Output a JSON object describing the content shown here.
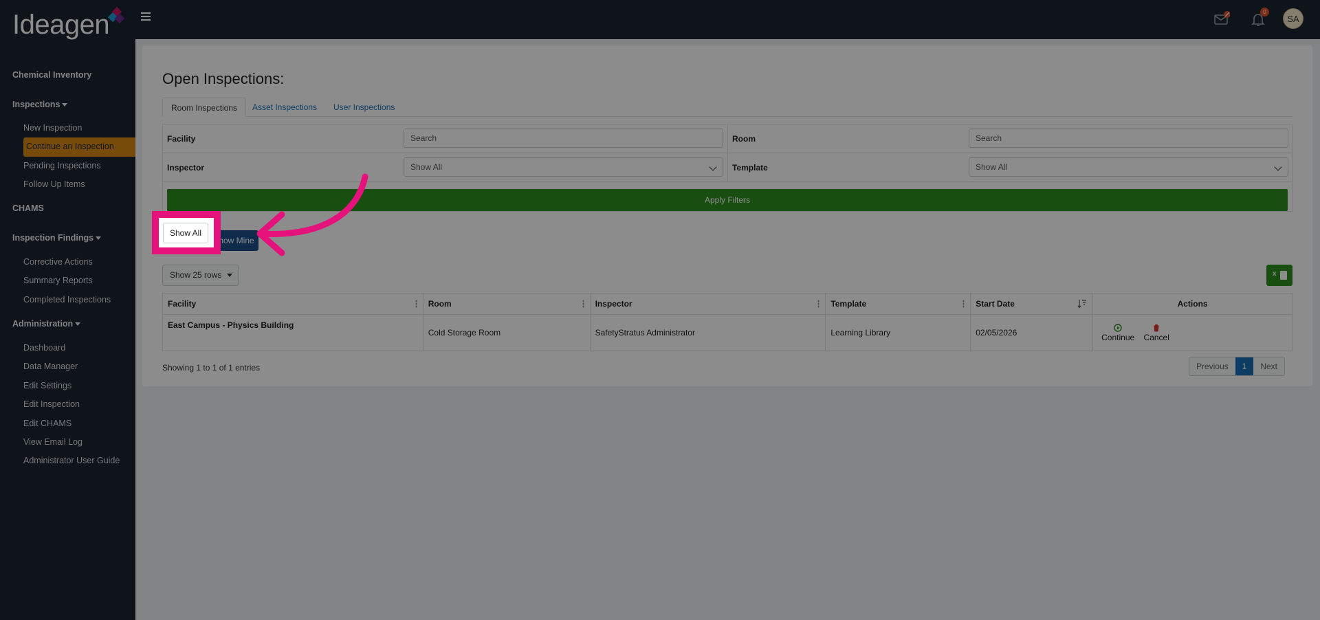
{
  "brand": {
    "logo_text": "Ideagen"
  },
  "sidebar": {
    "sections": [
      {
        "label": "Chemical Inventory"
      },
      {
        "label": "Inspections"
      },
      {
        "label": "CHAMS"
      },
      {
        "label": "Inspection Findings"
      },
      {
        "label": "Administration"
      }
    ],
    "items": [
      {
        "label": "New Inspection"
      },
      {
        "label": "Continue an Inspection"
      },
      {
        "label": "Pending Inspections"
      },
      {
        "label": "Follow Up Items"
      },
      {
        "label": "Corrective Actions"
      },
      {
        "label": "Summary Reports"
      },
      {
        "label": "Completed Inspections"
      },
      {
        "label": "Dashboard"
      },
      {
        "label": "Data Manager"
      },
      {
        "label": "Edit Settings"
      },
      {
        "label": "Edit Inspection"
      },
      {
        "label": "Edit CHAMS"
      },
      {
        "label": "View Email Log"
      },
      {
        "label": "Administrator User Guide"
      }
    ]
  },
  "topbar": {
    "notification_count": "0",
    "avatar_initials": "SA"
  },
  "page": {
    "title": "Open Inspections:"
  },
  "tabs": [
    {
      "label": "Room Inspections"
    },
    {
      "label": "Asset Inspections"
    },
    {
      "label": "User Inspections"
    }
  ],
  "filters": {
    "facility_label": "Facility",
    "facility_placeholder": "Search",
    "room_label": "Room",
    "room_placeholder": "Search",
    "inspector_label": "Inspector",
    "inspector_value": "Show All",
    "template_label": "Template",
    "template_value": "Show All",
    "apply_label": "Apply Filters"
  },
  "toggle": {
    "show_all": "Show All",
    "show_mine": "Show Mine"
  },
  "rows_select": "Show 25 rows",
  "excel": "x",
  "table": {
    "headers": [
      "Facility",
      "Room",
      "Inspector",
      "Template",
      "Start Date",
      "Actions"
    ],
    "rows": [
      {
        "facility": "East Campus - Physics Building",
        "room": "Cold Storage Room",
        "inspector": "SafetyStratus Administrator",
        "template": "Learning Library",
        "start_date": "02/05/2026",
        "continue": "Continue",
        "cancel": "Cancel"
      }
    ]
  },
  "footer": {
    "showing": "Showing 1 to 1 of 1 entries"
  },
  "pager": {
    "previous": "Previous",
    "current": "1",
    "next": "Next"
  },
  "colors": {
    "accent": "#e6127c",
    "active_nav": "#d98a14",
    "apply": "#2f8f1f",
    "link": "#1b6fb5"
  }
}
